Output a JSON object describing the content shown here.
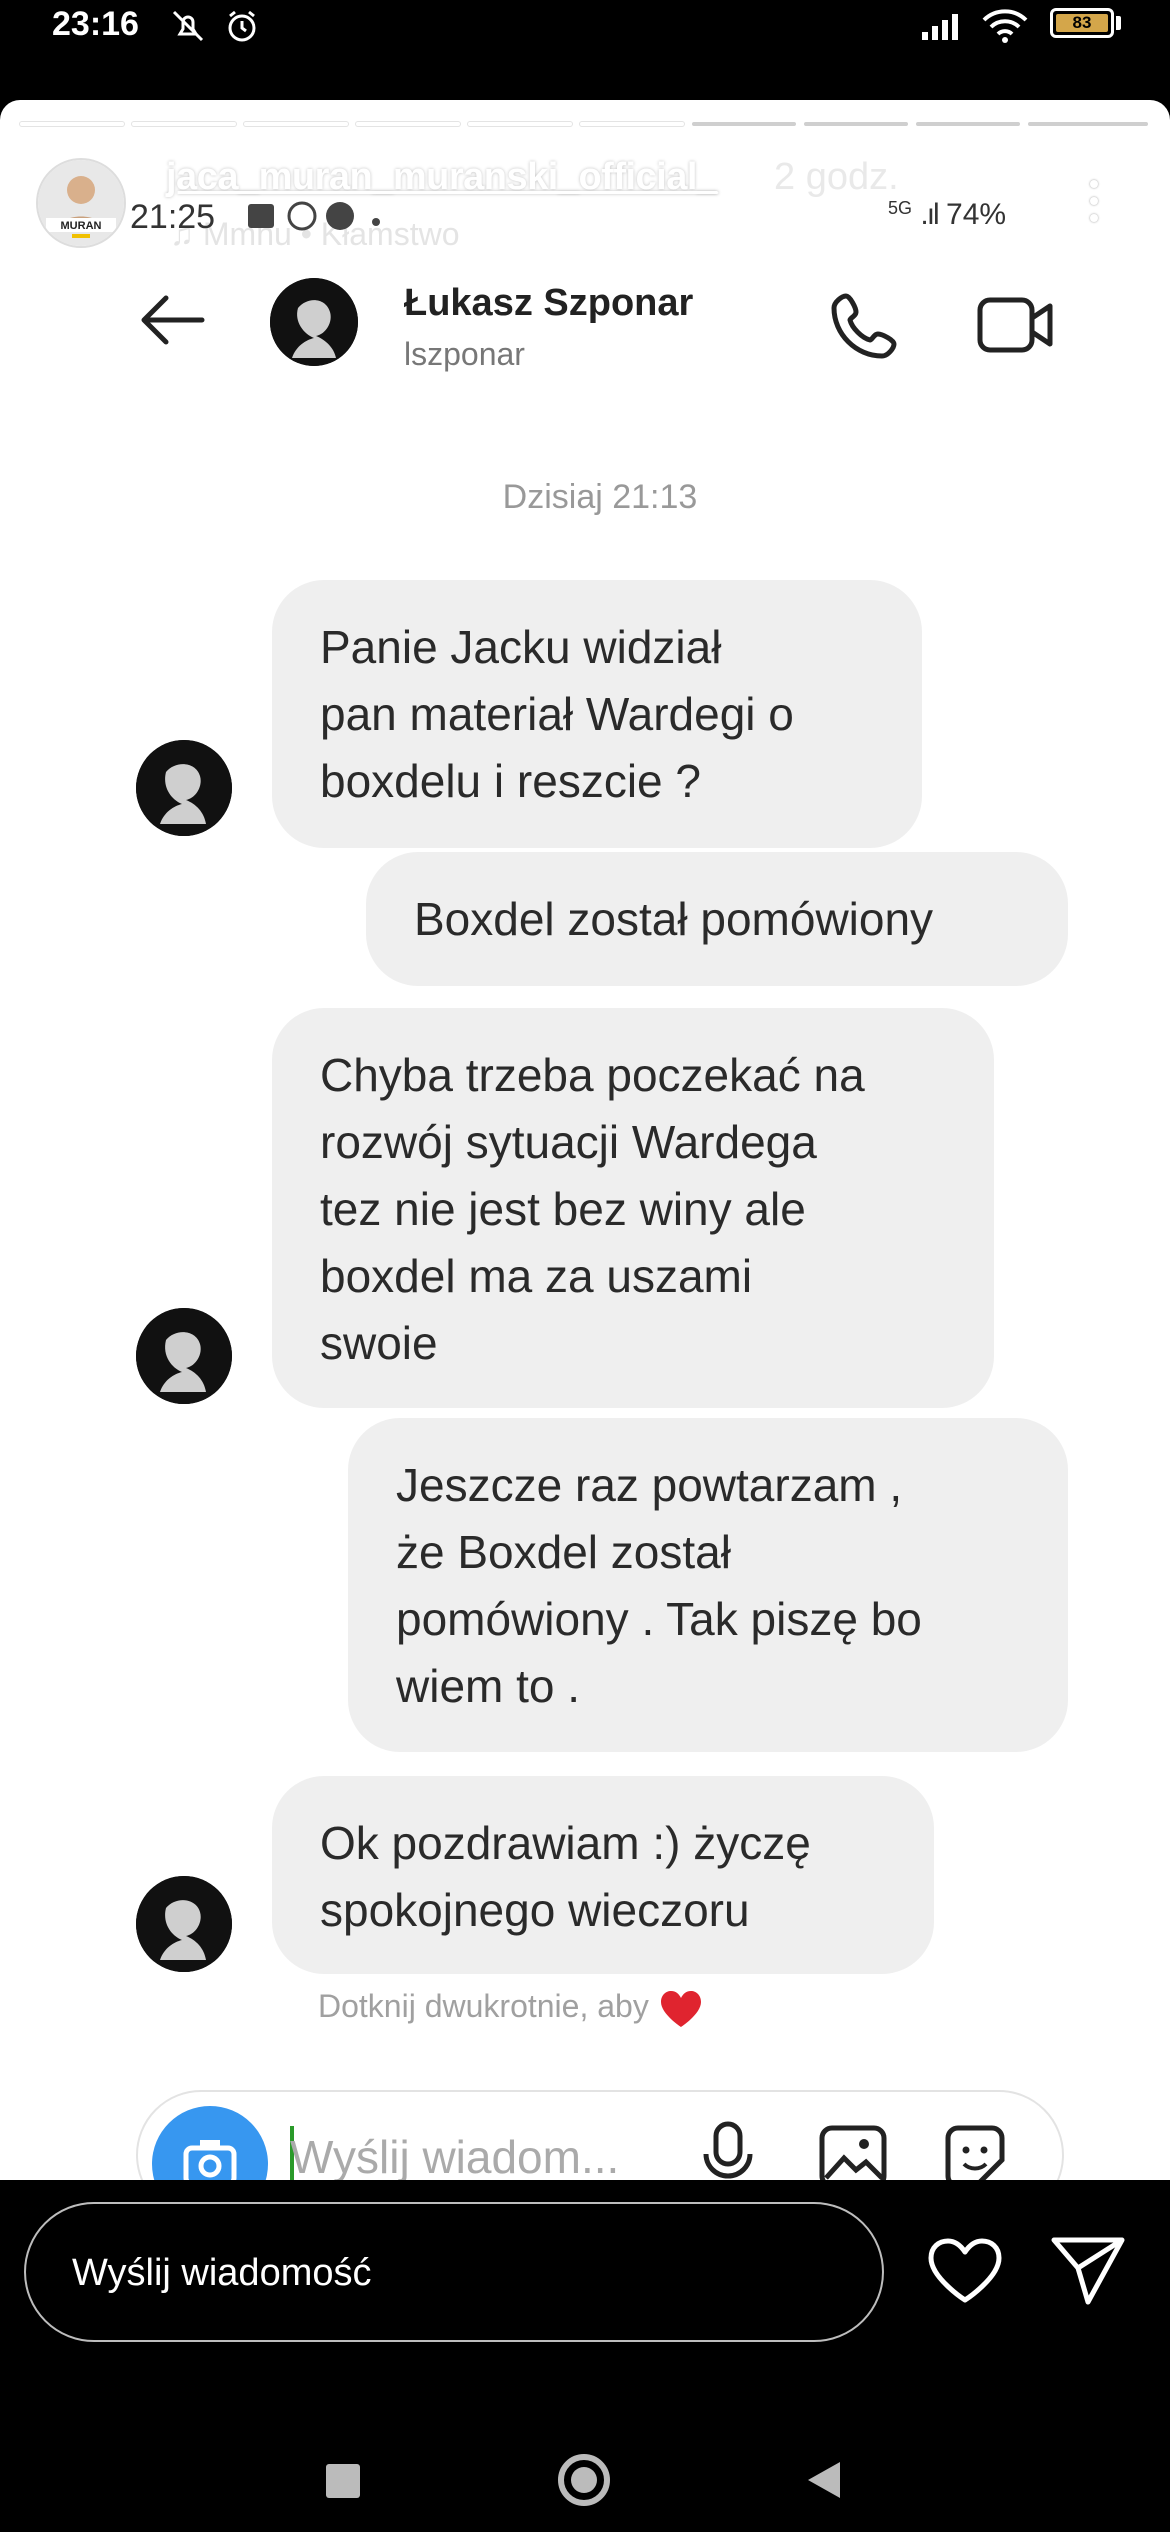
{
  "status_bar": {
    "time": "23:16",
    "battery": "83"
  },
  "story": {
    "username": "jaca_muran_muranski_official_",
    "age": "2 godz.",
    "music": "♫ Mmnu • Kłamstwo",
    "avatar_label": "MURAN"
  },
  "screenshot": {
    "status_time": "21:25",
    "status_right": "74%",
    "network": "5G",
    "contact_name": "Łukasz Szponar",
    "contact_handle": "lszponar",
    "date_separator": "Dzisiaj 21:13",
    "messages": [
      {
        "side": "incoming",
        "lines": [
          "Panie Jacku widział",
          "pan materiał Wardegi o",
          "boxdelu i reszcie ?"
        ]
      },
      {
        "side": "outgoing",
        "lines": [
          "Boxdel został pomówiony"
        ]
      },
      {
        "side": "incoming",
        "lines": [
          "Chyba trzeba poczekać na",
          "rozwój sytuacji Wardega",
          "tez nie jest bez winy ale",
          "boxdel ma za uszami",
          "swoie"
        ]
      },
      {
        "side": "outgoing",
        "lines": [
          "Jeszcze raz powtarzam ,",
          "że Boxdel został",
          "pomówiony . Tak piszę bo",
          "wiem to ."
        ]
      },
      {
        "side": "incoming",
        "lines": [
          "Ok pozdrawiam :) życzę",
          "spokojnego wieczoru"
        ]
      }
    ],
    "double_tap_hint": "Dotknij dwukrotnie, aby",
    "composer_placeholder": "Wyślij wiadom..."
  },
  "reply_bar": {
    "placeholder": "Wyślij wiadomość"
  },
  "colors": {
    "bubble": "#efefef",
    "accent_blue": "#3797f0",
    "heart": "#e0242f",
    "battery": "#d4a64a"
  },
  "icons": [
    "mute-icon",
    "alarm-icon",
    "signal-icon",
    "wifi-icon",
    "battery-icon",
    "back-arrow-icon",
    "phone-icon",
    "video-icon",
    "camera-icon",
    "mic-icon",
    "image-icon",
    "sticker-icon",
    "heart-icon",
    "send-icon",
    "more-icon"
  ]
}
